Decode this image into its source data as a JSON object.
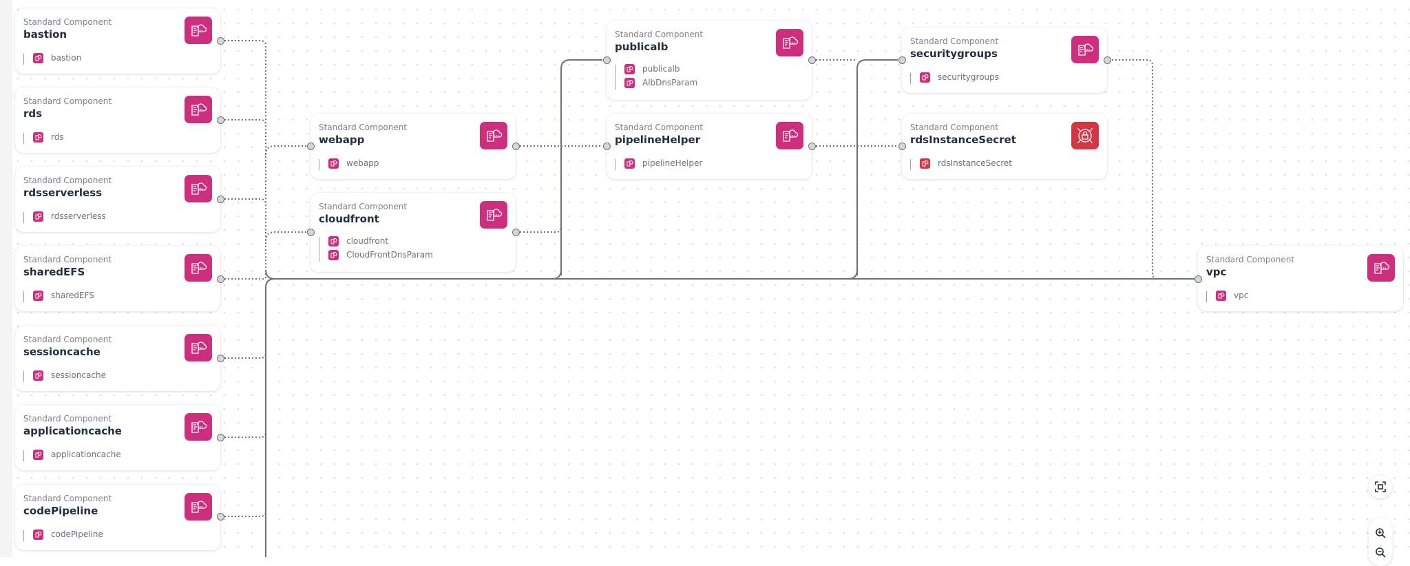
{
  "canvas": {
    "accent_color": "#cd2f7e",
    "secret_color": "#d13843"
  },
  "nodes": [
    {
      "id": "bastion",
      "kind": "Standard Component",
      "title": "bastion",
      "resources": [
        {
          "label": "bastion",
          "icon": "cloud-template-icon"
        }
      ]
    },
    {
      "id": "rds",
      "kind": "Standard Component",
      "title": "rds",
      "resources": [
        {
          "label": "rds",
          "icon": "cloud-template-icon"
        }
      ]
    },
    {
      "id": "rdsserverless",
      "kind": "Standard Component",
      "title": "rdsserverless",
      "resources": [
        {
          "label": "rdsserverless",
          "icon": "cloud-template-icon"
        }
      ]
    },
    {
      "id": "sharedEFS",
      "kind": "Standard Component",
      "title": "sharedEFS",
      "resources": [
        {
          "label": "sharedEFS",
          "icon": "cloud-template-icon"
        }
      ]
    },
    {
      "id": "sessioncache",
      "kind": "Standard Component",
      "title": "sessioncache",
      "resources": [
        {
          "label": "sessioncache",
          "icon": "cloud-template-icon"
        }
      ]
    },
    {
      "id": "applicationcache",
      "kind": "Standard Component",
      "title": "applicationcache",
      "resources": [
        {
          "label": "applicationcache",
          "icon": "cloud-template-icon"
        }
      ]
    },
    {
      "id": "codePipeline",
      "kind": "Standard Component",
      "title": "codePipeline",
      "resources": [
        {
          "label": "codePipeline",
          "icon": "cloud-template-icon"
        }
      ]
    },
    {
      "id": "webapp",
      "kind": "Standard Component",
      "title": "webapp",
      "resources": [
        {
          "label": "webapp",
          "icon": "cloud-template-icon"
        }
      ]
    },
    {
      "id": "cloudfront",
      "kind": "Standard Component",
      "title": "cloudfront",
      "resources": [
        {
          "label": "cloudfront",
          "icon": "cloud-template-icon"
        },
        {
          "label": "CloudFrontDnsParam",
          "icon": "parameter-icon"
        }
      ]
    },
    {
      "id": "publicalb",
      "kind": "Standard Component",
      "title": "publicalb",
      "resources": [
        {
          "label": "publicalb",
          "icon": "load-balancer-icon"
        },
        {
          "label": "AlbDnsParam",
          "icon": "parameter-icon"
        }
      ]
    },
    {
      "id": "pipelineHelper",
      "kind": "Standard Component",
      "title": "pipelineHelper",
      "resources": [
        {
          "label": "pipelineHelper",
          "icon": "cloud-template-icon"
        }
      ]
    },
    {
      "id": "securitygroups",
      "kind": "Standard Component",
      "title": "securitygroups",
      "resources": [
        {
          "label": "securitygroups",
          "icon": "cloud-template-icon"
        }
      ]
    },
    {
      "id": "rdsInstanceSecret",
      "kind": "Standard Component",
      "title": "rdsInstanceSecret",
      "resources": [
        {
          "label": "rdsInstanceSecret",
          "icon": "secret-icon"
        }
      ]
    },
    {
      "id": "vpc",
      "kind": "Standard Component",
      "title": "vpc",
      "resources": [
        {
          "label": "vpc",
          "icon": "cloud-template-icon"
        }
      ]
    }
  ],
  "edges": [
    {
      "from": "bastion",
      "to": "vpc"
    },
    {
      "from": "rds",
      "to": "vpc"
    },
    {
      "from": "rdsserverless",
      "to": "vpc"
    },
    {
      "from": "sharedEFS",
      "to": "vpc"
    },
    {
      "from": "sessioncache",
      "to": "vpc"
    },
    {
      "from": "applicationcache",
      "to": "vpc"
    },
    {
      "from": "codePipeline",
      "to": "vpc"
    },
    {
      "from": "webapp",
      "to": "publicalb"
    },
    {
      "from": "webapp",
      "to": "pipelineHelper"
    },
    {
      "from": "cloudfront",
      "to": "publicalb"
    },
    {
      "from": "publicalb",
      "to": "securitygroups"
    },
    {
      "from": "pipelineHelper",
      "to": "rdsInstanceSecret"
    },
    {
      "from": "securitygroups",
      "to": "vpc"
    }
  ],
  "controls": {
    "fit_view": "fit-view",
    "zoom_in": "zoom-in",
    "zoom_out": "zoom-out"
  }
}
